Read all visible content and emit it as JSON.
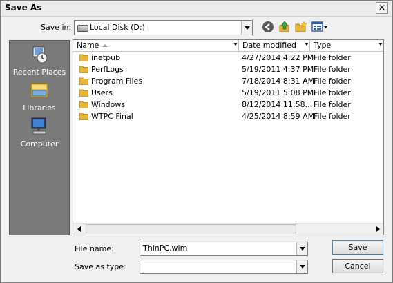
{
  "dialog": {
    "title": "Save As",
    "close_glyph": "✕"
  },
  "location": {
    "label": "Save in:",
    "value": "Local Disk (D:)",
    "icon": "drive-icon"
  },
  "toolbar": {
    "back_icon": "back-icon",
    "up_icon": "up-folder-icon",
    "new_folder_icon": "new-folder-icon",
    "views_icon": "views-menu-icon"
  },
  "places": [
    {
      "label": "Recent Places",
      "icon": "recent-places-icon"
    },
    {
      "label": "Libraries",
      "icon": "libraries-icon"
    },
    {
      "label": "Computer",
      "icon": "computer-icon"
    }
  ],
  "columns": {
    "name": "Name",
    "date": "Date modified",
    "type": "Type"
  },
  "files": [
    {
      "name": "inetpub",
      "date": "4/27/2014 4:22 PM",
      "type": "File folder"
    },
    {
      "name": "PerfLogs",
      "date": "5/19/2011 4:37 PM",
      "type": "File folder"
    },
    {
      "name": "Program Files",
      "date": "7/18/2014 8:31 AM",
      "type": "File folder"
    },
    {
      "name": "Users",
      "date": "5/19/2011 5:08 PM",
      "type": "File folder"
    },
    {
      "name": "Windows",
      "date": "8/12/2014 11:58...",
      "type": "File folder"
    },
    {
      "name": "WTPC Final",
      "date": "4/25/2014 8:59 AM",
      "type": "File folder"
    }
  ],
  "filename": {
    "label": "File name:",
    "value": "ThinPC.wim"
  },
  "savetype": {
    "label": "Save as type:",
    "value": ""
  },
  "buttons": {
    "save": "Save",
    "cancel": "Cancel"
  },
  "colors": {
    "sidebar": "#7a7a7a",
    "folder": "#e8b83a"
  }
}
